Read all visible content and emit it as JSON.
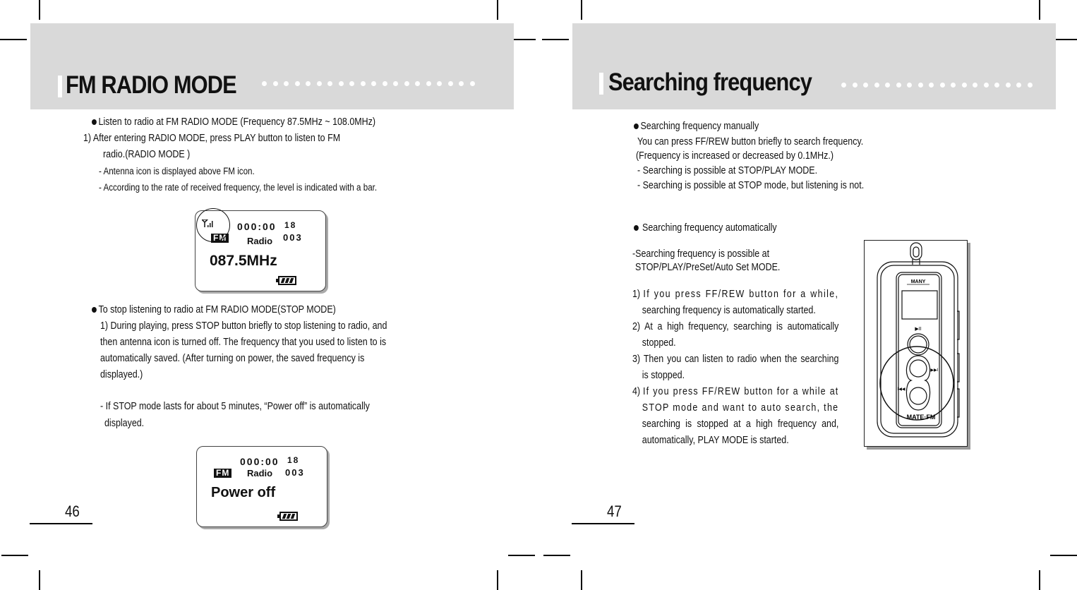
{
  "left_page": {
    "title": "FM RADIO MODE",
    "page_number": "46",
    "section1": {
      "heading": "Listen to radio at FM RADIO MODE (Frequency 87.5MHz ~ 108.0MHz)",
      "step1_line1": "1)  After entering RADIO MODE, press PLAY button to listen to FM",
      "step1_line2": "radio.(RADIO MODE )",
      "note1": "- Antenna icon is displayed above FM icon.",
      "note2": "- According to the rate of received frequency, the level is indicated with a bar."
    },
    "lcd_play": {
      "antenna": "Yııl",
      "time": "000:00",
      "track": "18",
      "fm_label": "FM",
      "mode": "Radio",
      "preset": "003",
      "main": "087.5MHz"
    },
    "section2": {
      "heading": "To stop listening to radio at FM RADIO MODE(STOP MODE)",
      "lines": [
        "1) During playing, press STOP button briefly to stop listening to radio, and",
        "then antenna icon is turned off. The frequency that you used to listen to is",
        "automatically saved. (After turning on power, the saved frequency is",
        "displayed.)"
      ],
      "note_line1": "- If STOP mode lasts for about 5 minutes,  “Power off” is automatically",
      "note_line2": "displayed."
    },
    "lcd_stop": {
      "time": "000:00",
      "track": "18",
      "fm_label": "FM",
      "mode": "Radio",
      "preset": "003",
      "main": "Power off"
    }
  },
  "right_page": {
    "title": "Searching frequency",
    "page_number": "47",
    "manual": {
      "heading": "Searching frequency manually",
      "line1": "You can press FF/REW button briefly to search frequency.",
      "line2": "(Frequency is increased or decreased by 0.1MHz.)",
      "note1": "- Searching is possible at STOP/PLAY MODE.",
      "note2": "- Searching is possible at STOP mode, but listening is not."
    },
    "auto": {
      "heading": "Searching frequency automatically",
      "possible_line1": "-Searching frequency is possible at",
      "possible_line2": "STOP/PLAY/PreSet/Auto Set MODE.",
      "steps": [
        {
          "num": "1)",
          "lines": [
            "If you press FF/REW button for a while,",
            "searching frequency is automatically started."
          ]
        },
        {
          "num": "2)",
          "lines": [
            "At a high frequency, searching is automatically",
            "stopped."
          ]
        },
        {
          "num": "3)",
          "lines": [
            "Then you can listen to radio when the searching",
            "is stopped."
          ]
        },
        {
          "num": "4)",
          "lines": [
            "If you press FF/REW button for a while at",
            "STOP mode and want to auto search, the",
            "searching is stopped at a high frequency and,",
            "automatically, PLAY MODE is started."
          ]
        }
      ]
    },
    "device": {
      "brand": "MANY",
      "play_pause_symbol": "▶II",
      "ff_symbol": "▶▶I",
      "rew_symbol": "I◀◀",
      "model": "MATE·FM"
    }
  }
}
